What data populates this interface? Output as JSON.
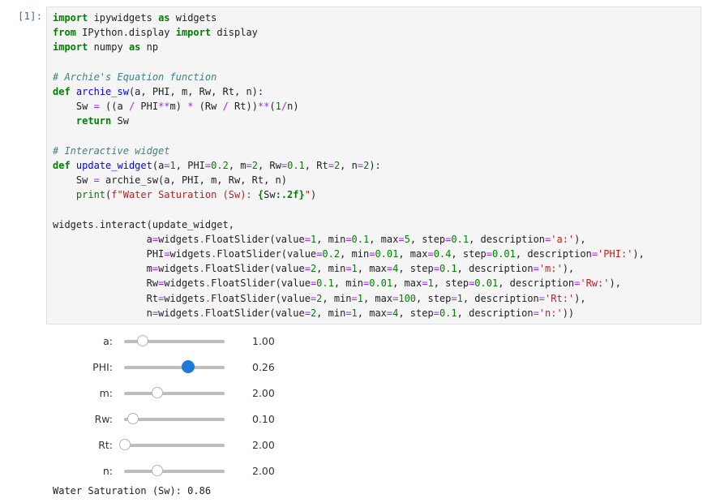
{
  "cell": {
    "prompt": "[1]:",
    "code_lines": [
      [
        [
          "kw",
          "import"
        ],
        [
          "t",
          " ipywidgets "
        ],
        [
          "kw",
          "as"
        ],
        [
          "t",
          " widgets"
        ]
      ],
      [
        [
          "kw",
          "from"
        ],
        [
          "t",
          " IPython.display "
        ],
        [
          "kw",
          "import"
        ],
        [
          "t",
          " display"
        ]
      ],
      [
        [
          "kw",
          "import"
        ],
        [
          "t",
          " numpy "
        ],
        [
          "kw",
          "as"
        ],
        [
          "t",
          " np"
        ]
      ],
      [
        [
          "t",
          ""
        ]
      ],
      [
        [
          "cm",
          "# Archie's Equation function"
        ]
      ],
      [
        [
          "kw",
          "def"
        ],
        [
          "t",
          " "
        ],
        [
          "fn",
          "archie_sw"
        ],
        [
          "t",
          "(a, PHI, m, Rw, Rt, n):"
        ]
      ],
      [
        [
          "t",
          "    Sw "
        ],
        [
          "op",
          "="
        ],
        [
          "t",
          " ((a "
        ],
        [
          "op",
          "/"
        ],
        [
          "t",
          " PHI"
        ],
        [
          "op",
          "**"
        ],
        [
          "t",
          "m) "
        ],
        [
          "op",
          "*"
        ],
        [
          "t",
          " (Rw "
        ],
        [
          "op",
          "/"
        ],
        [
          "t",
          " Rt))"
        ],
        [
          "op",
          "**"
        ],
        [
          "t",
          "("
        ],
        [
          "nm",
          "1"
        ],
        [
          "op",
          "/"
        ],
        [
          "t",
          "n)"
        ]
      ],
      [
        [
          "t",
          "    "
        ],
        [
          "kw",
          "return"
        ],
        [
          "t",
          " Sw"
        ]
      ],
      [
        [
          "t",
          ""
        ]
      ],
      [
        [
          "cm",
          "# Interactive widget"
        ]
      ],
      [
        [
          "kw",
          "def"
        ],
        [
          "t",
          " "
        ],
        [
          "fn",
          "update_widget"
        ],
        [
          "t",
          "(a"
        ],
        [
          "op",
          "="
        ],
        [
          "nm",
          "1"
        ],
        [
          "t",
          ", PHI"
        ],
        [
          "op",
          "="
        ],
        [
          "nm",
          "0.2"
        ],
        [
          "t",
          ", m"
        ],
        [
          "op",
          "="
        ],
        [
          "nm",
          "2"
        ],
        [
          "t",
          ", Rw"
        ],
        [
          "op",
          "="
        ],
        [
          "nm",
          "0.1"
        ],
        [
          "t",
          ", Rt"
        ],
        [
          "op",
          "="
        ],
        [
          "nm",
          "2"
        ],
        [
          "t",
          ", n"
        ],
        [
          "op",
          "="
        ],
        [
          "nm",
          "2"
        ],
        [
          "t",
          "):"
        ]
      ],
      [
        [
          "t",
          "    Sw "
        ],
        [
          "op",
          "="
        ],
        [
          "t",
          " archie_sw(a, PHI, m, Rw, Rt, n)"
        ]
      ],
      [
        [
          "t",
          "    "
        ],
        [
          "bi",
          "print"
        ],
        [
          "t",
          "("
        ],
        [
          "st",
          "f\"Water Saturation (Sw): "
        ],
        [
          "kw",
          "{"
        ],
        [
          "t",
          "Sw"
        ],
        [
          "kw",
          ":.2f}"
        ],
        [
          "st",
          "\""
        ],
        [
          "t",
          ")"
        ]
      ],
      [
        [
          "t",
          ""
        ]
      ],
      [
        [
          "t",
          "widgets"
        ],
        [
          "op",
          "."
        ],
        [
          "t",
          "interact(update_widget,"
        ]
      ],
      [
        [
          "t",
          "                a"
        ],
        [
          "op",
          "="
        ],
        [
          "t",
          "widgets"
        ],
        [
          "op",
          "."
        ],
        [
          "t",
          "FloatSlider(value"
        ],
        [
          "op",
          "="
        ],
        [
          "nm",
          "1"
        ],
        [
          "t",
          ", min"
        ],
        [
          "op",
          "="
        ],
        [
          "nm",
          "0.1"
        ],
        [
          "t",
          ", max"
        ],
        [
          "op",
          "="
        ],
        [
          "nm",
          "5"
        ],
        [
          "t",
          ", step"
        ],
        [
          "op",
          "="
        ],
        [
          "nm",
          "0.1"
        ],
        [
          "t",
          ", description"
        ],
        [
          "op",
          "="
        ],
        [
          "st",
          "'a:'"
        ],
        [
          "t",
          "),"
        ]
      ],
      [
        [
          "t",
          "                PHI"
        ],
        [
          "op",
          "="
        ],
        [
          "t",
          "widgets"
        ],
        [
          "op",
          "."
        ],
        [
          "t",
          "FloatSlider(value"
        ],
        [
          "op",
          "="
        ],
        [
          "nm",
          "0.2"
        ],
        [
          "t",
          ", min"
        ],
        [
          "op",
          "="
        ],
        [
          "nm",
          "0.01"
        ],
        [
          "t",
          ", max"
        ],
        [
          "op",
          "="
        ],
        [
          "nm",
          "0.4"
        ],
        [
          "t",
          ", step"
        ],
        [
          "op",
          "="
        ],
        [
          "nm",
          "0.01"
        ],
        [
          "t",
          ", description"
        ],
        [
          "op",
          "="
        ],
        [
          "st",
          "'PHI:'"
        ],
        [
          "t",
          "),"
        ]
      ],
      [
        [
          "t",
          "                m"
        ],
        [
          "op",
          "="
        ],
        [
          "t",
          "widgets"
        ],
        [
          "op",
          "."
        ],
        [
          "t",
          "FloatSlider(value"
        ],
        [
          "op",
          "="
        ],
        [
          "nm",
          "2"
        ],
        [
          "t",
          ", min"
        ],
        [
          "op",
          "="
        ],
        [
          "nm",
          "1"
        ],
        [
          "t",
          ", max"
        ],
        [
          "op",
          "="
        ],
        [
          "nm",
          "4"
        ],
        [
          "t",
          ", step"
        ],
        [
          "op",
          "="
        ],
        [
          "nm",
          "0.1"
        ],
        [
          "t",
          ", description"
        ],
        [
          "op",
          "="
        ],
        [
          "st",
          "'m:'"
        ],
        [
          "t",
          "),"
        ]
      ],
      [
        [
          "t",
          "                Rw"
        ],
        [
          "op",
          "="
        ],
        [
          "t",
          "widgets"
        ],
        [
          "op",
          "."
        ],
        [
          "t",
          "FloatSlider(value"
        ],
        [
          "op",
          "="
        ],
        [
          "nm",
          "0.1"
        ],
        [
          "t",
          ", min"
        ],
        [
          "op",
          "="
        ],
        [
          "nm",
          "0.01"
        ],
        [
          "t",
          ", max"
        ],
        [
          "op",
          "="
        ],
        [
          "nm",
          "1"
        ],
        [
          "t",
          ", step"
        ],
        [
          "op",
          "="
        ],
        [
          "nm",
          "0.01"
        ],
        [
          "t",
          ", description"
        ],
        [
          "op",
          "="
        ],
        [
          "st",
          "'Rw:'"
        ],
        [
          "t",
          "),"
        ]
      ],
      [
        [
          "t",
          "                Rt"
        ],
        [
          "op",
          "="
        ],
        [
          "t",
          "widgets"
        ],
        [
          "op",
          "."
        ],
        [
          "t",
          "FloatSlider(value"
        ],
        [
          "op",
          "="
        ],
        [
          "nm",
          "2"
        ],
        [
          "t",
          ", min"
        ],
        [
          "op",
          "="
        ],
        [
          "nm",
          "1"
        ],
        [
          "t",
          ", max"
        ],
        [
          "op",
          "="
        ],
        [
          "nm",
          "100"
        ],
        [
          "t",
          ", step"
        ],
        [
          "op",
          "="
        ],
        [
          "nm",
          "1"
        ],
        [
          "t",
          ", description"
        ],
        [
          "op",
          "="
        ],
        [
          "st",
          "'Rt:'"
        ],
        [
          "t",
          "),"
        ]
      ],
      [
        [
          "t",
          "                n"
        ],
        [
          "op",
          "="
        ],
        [
          "t",
          "widgets"
        ],
        [
          "op",
          "."
        ],
        [
          "t",
          "FloatSlider(value"
        ],
        [
          "op",
          "="
        ],
        [
          "nm",
          "2"
        ],
        [
          "t",
          ", min"
        ],
        [
          "op",
          "="
        ],
        [
          "nm",
          "1"
        ],
        [
          "t",
          ", max"
        ],
        [
          "op",
          "="
        ],
        [
          "nm",
          "4"
        ],
        [
          "t",
          ", step"
        ],
        [
          "op",
          "="
        ],
        [
          "nm",
          "0.1"
        ],
        [
          "t",
          ", description"
        ],
        [
          "op",
          "="
        ],
        [
          "st",
          "'n:'"
        ],
        [
          "t",
          "))"
        ]
      ]
    ]
  },
  "sliders": [
    {
      "label": "a:",
      "value_text": "1.00",
      "fraction": 0.184,
      "active": false
    },
    {
      "label": "PHI:",
      "value_text": "0.26",
      "fraction": 0.641,
      "active": true
    },
    {
      "label": "m:",
      "value_text": "2.00",
      "fraction": 0.333,
      "active": false
    },
    {
      "label": "Rw:",
      "value_text": "0.10",
      "fraction": 0.091,
      "active": false
    },
    {
      "label": "Rt:",
      "value_text": "2.00",
      "fraction": 0.01,
      "active": false
    },
    {
      "label": "n:",
      "value_text": "2.00",
      "fraction": 0.333,
      "active": false
    }
  ],
  "output": {
    "text": "Water Saturation (Sw): 0.86"
  },
  "colors": {
    "active_handle": "#1e7ad6",
    "track": "#bdbdbd"
  }
}
